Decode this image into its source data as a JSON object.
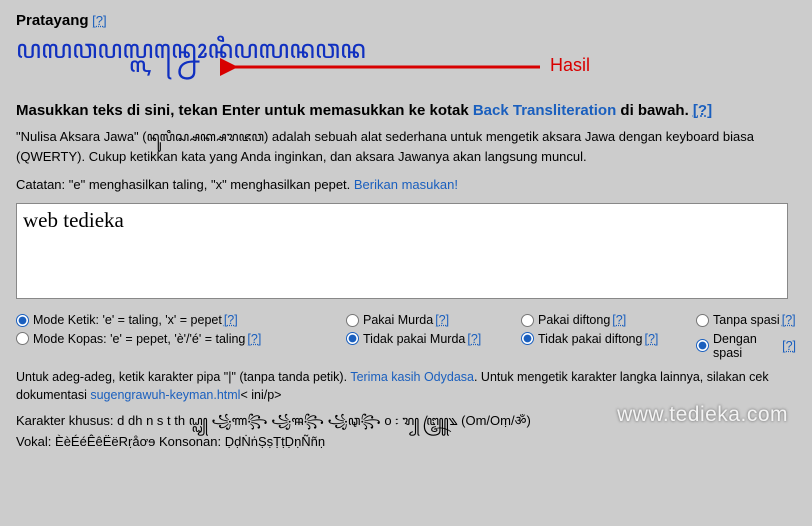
{
  "title": "Pratayang",
  "help_glyph": "[?]",
  "javanese_output": "ꦥꦭꦮꦥꦭ꧀ꦭꦤ꧀ꦤꦺꦴꦤꦶꦥꦭꦤꦮꦤ",
  "hasil_label": "Hasil",
  "heading2_pre": "Masukkan teks di sini, tekan Enter untuk memasukkan ke kotak ",
  "heading2_link": "Back Transliteration",
  "heading2_post": " di bawah.",
  "intro_pre": "\"Nulisa Aksara Jawa\" (",
  "intro_js": "ꦤꦸꦭꦶꦱ꧀ꦱꦏ꧀ꦱꦫꦗꦮ",
  "intro_post": ") adalah sebuah alat sederhana untuk mengetik aksara Jawa dengan keyboard biasa (QWERTY). Cukup ketikkan kata yang Anda inginkan, dan aksara Jawanya akan langsung muncul.",
  "catatan_pre": "Catatan: \"e\" menghasilkan taling, \"x\" menghasilkan pepet. ",
  "catatan_link": "Berikan masukan!",
  "input_value": "web tedieka",
  "radios": {
    "r1c1": "Mode Ketik: 'e' = taling, 'x' = pepet",
    "r2c1": "Mode Kopas: 'e' = pepet, 'è'/'é' = taling",
    "r1c2": "Pakai Murda",
    "r2c2": "Tidak pakai Murda",
    "r1c3": "Pakai diftong",
    "r2c3": "Tidak pakai diftong",
    "r1c4": "Tanpa spasi",
    "r2c4": "Dengan spasi"
  },
  "footer_pre": "Untuk adeg-adeg, ketik karakter pipa \"|\" (tanpa tanda petik). ",
  "footer_link1": "Terima kasih Odydasa",
  "footer_mid": ". Untuk mengetik karakter langka lainnya, silakan cek dokumentasi ",
  "footer_link2": "sugengrawuh-keyman.html",
  "footer_post": "< ini/p>",
  "khusus_line1": "Karakter khusus: d dh n s t th ꦝ꧀ꦞ꧀ ꧁ꦟ꧂ ꧁ꦯ꧂ ꧁ꦡ꧂ o ꧇ ꦫ꧀ ꧅꧉ (Om/Oṃ/ॐ)",
  "khusus_line2": "Vokal: ÈèÉéÊêËëRṛåơɘ Konsonan: ḌḍṄṅṢṣṬṭḌṇÑñṇ",
  "watermark": "www.tedieka.com"
}
